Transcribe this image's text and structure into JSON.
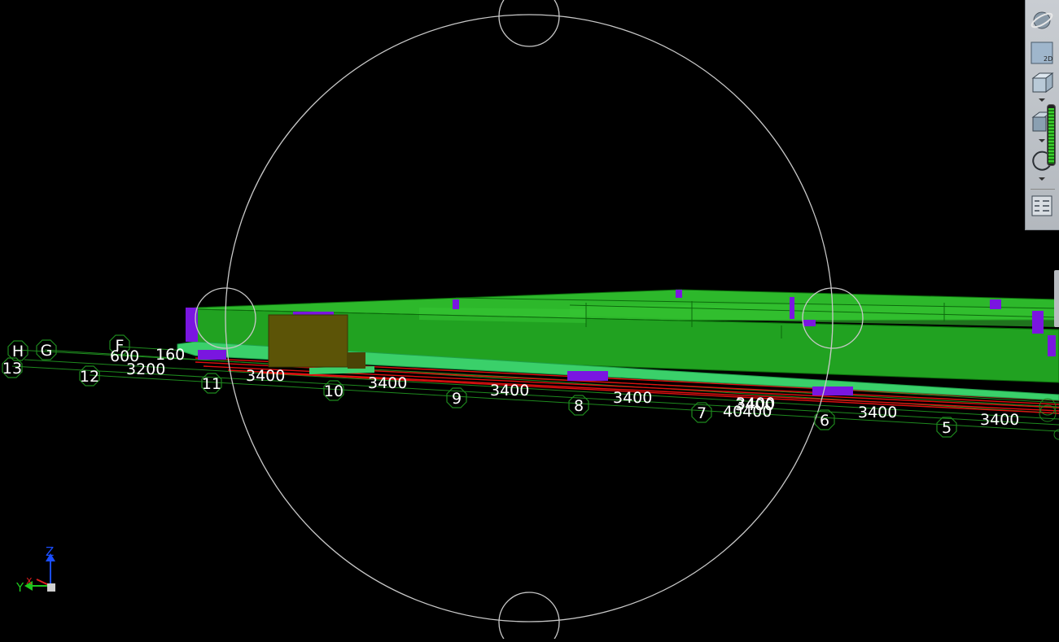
{
  "grid": {
    "letters": [
      "H",
      "G",
      "F"
    ],
    "numbers": [
      "13",
      "12",
      "11",
      "10",
      "9",
      "8",
      "7",
      "6",
      "5"
    ]
  },
  "dimensions": {
    "left_labels": [
      "600",
      "160",
      "3200"
    ],
    "spans": [
      "3400",
      "3400",
      "3400",
      "3400",
      "3400",
      "3400",
      "3400",
      "3400"
    ],
    "overlap_label": "40400"
  },
  "axis_triad": {
    "z": "Z",
    "y": "Y",
    "x": "X"
  },
  "toolbar": {
    "tools": [
      {
        "icon": "orbit-globe-icon"
      },
      {
        "icon": "2d-view-icon",
        "label": "2D"
      },
      {
        "icon": "wireframe-cube-icon"
      },
      {
        "icon": "shaded-cube-icon"
      },
      {
        "icon": "rotate-icon"
      },
      {
        "icon": "view-settings-icon"
      }
    ],
    "zoom_level": 0.92
  },
  "colors": {
    "background": "#000000",
    "slab_top": "#2db82b",
    "slab_side": "#21a221",
    "column": "#7a16e0",
    "beam_line": "#e01010",
    "gridline": "#1e8a1e",
    "orbit_circle": "#c8c8c8",
    "box": "#5c5407",
    "label": "#ffffff"
  }
}
